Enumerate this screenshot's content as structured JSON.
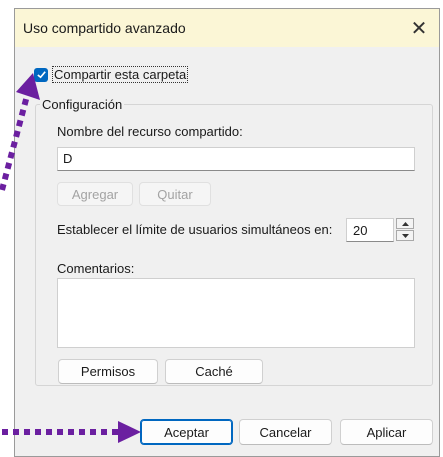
{
  "dialog": {
    "title": "Uso compartido avanzado",
    "close_icon": "close-icon",
    "share_checkbox": {
      "label": "Compartir esta carpeta",
      "checked": true
    },
    "configuration": {
      "legend": "Configuración",
      "share_name_label": "Nombre del recurso compartido:",
      "share_name_value": "D",
      "add_button": "Agregar",
      "remove_button": "Quitar",
      "user_limit_label": "Establecer el límite de usuarios simultáneos en:",
      "user_limit_value": "20",
      "comments_label": "Comentarios:",
      "comments_value": "",
      "permissions_button": "Permisos",
      "cache_button": "Caché"
    },
    "footer": {
      "ok_button": "Aceptar",
      "cancel_button": "Cancelar",
      "apply_button": "Aplicar"
    }
  },
  "colors": {
    "title_bar": "#fbf6d6",
    "checkbox_accent": "#0067c0",
    "annotation_arrow": "#6b1fa0"
  }
}
